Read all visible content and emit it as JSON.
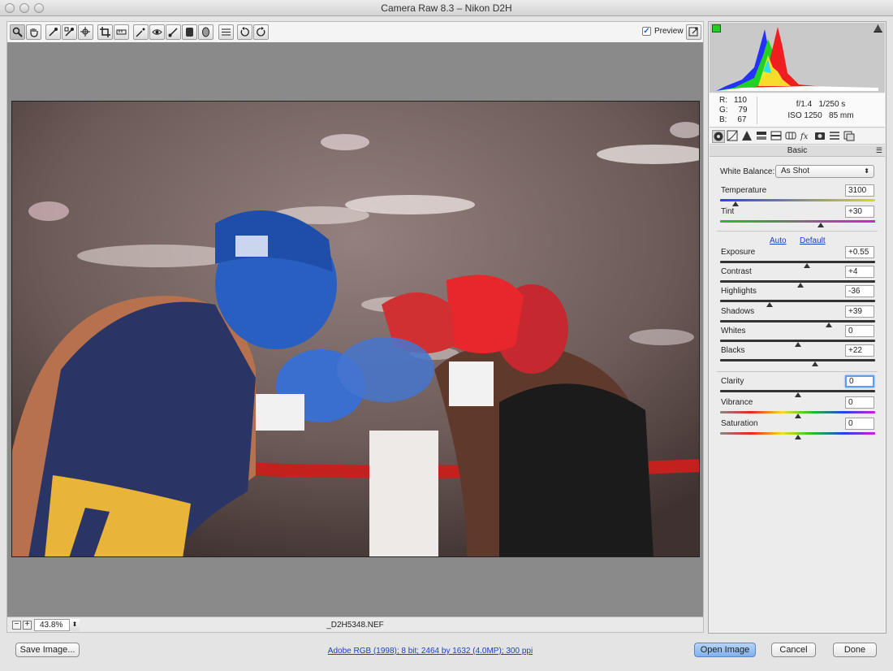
{
  "window": {
    "title": "Camera Raw 8.3  –  Nikon D2H"
  },
  "toolbar": {
    "tools": [
      "zoom-tool",
      "hand-tool",
      "white-balance-tool",
      "color-sampler-tool",
      "targeted-adjustment-tool",
      "crop-tool",
      "straighten-tool",
      "spot-removal-tool",
      "red-eye-tool",
      "adjustment-brush-tool",
      "graduated-filter-tool",
      "radial-filter-tool",
      "preferences",
      "rotate-left",
      "rotate-right"
    ],
    "preview_label": "Preview",
    "preview_checked": true
  },
  "status": {
    "zoom": "43.8%",
    "filename": "_D2H5348.NEF"
  },
  "info": {
    "r_label": "R:",
    "r": "110",
    "g_label": "G:",
    "g": "79",
    "b_label": "B:",
    "b": "67",
    "aperture": "f/1.4",
    "shutter": "1/250 s",
    "iso": "ISO 1250",
    "focal": "85 mm"
  },
  "panel": {
    "section_title": "Basic",
    "white_balance_label": "White Balance:",
    "white_balance_value": "As Shot",
    "auto_label": "Auto",
    "default_label": "Default",
    "sliders": {
      "temperature": {
        "label": "Temperature",
        "value": "3100",
        "pos": 0.1
      },
      "tint": {
        "label": "Tint",
        "value": "+30",
        "pos": 0.65
      },
      "exposure": {
        "label": "Exposure",
        "value": "+0.55",
        "pos": 0.56
      },
      "contrast": {
        "label": "Contrast",
        "value": "+4",
        "pos": 0.52
      },
      "highlights": {
        "label": "Highlights",
        "value": "-36",
        "pos": 0.32
      },
      "shadows": {
        "label": "Shadows",
        "value": "+39",
        "pos": 0.7
      },
      "whites": {
        "label": "Whites",
        "value": "0",
        "pos": 0.5
      },
      "blacks": {
        "label": "Blacks",
        "value": "+22",
        "pos": 0.61
      },
      "clarity": {
        "label": "Clarity",
        "value": "0",
        "pos": 0.5
      },
      "vibrance": {
        "label": "Vibrance",
        "value": "0",
        "pos": 0.5
      },
      "saturation": {
        "label": "Saturation",
        "value": "0",
        "pos": 0.5
      }
    }
  },
  "footer": {
    "save_label": "Save Image...",
    "workflow_link": "Adobe RGB (1998); 8 bit; 2464 by 1632 (4.0MP); 300 ppi",
    "open_label": "Open Image",
    "cancel_label": "Cancel",
    "done_label": "Done"
  },
  "colors": {
    "accent": "#5d9cf5",
    "link": "#1a3fc2",
    "primary_button": "#8fbcf2"
  }
}
